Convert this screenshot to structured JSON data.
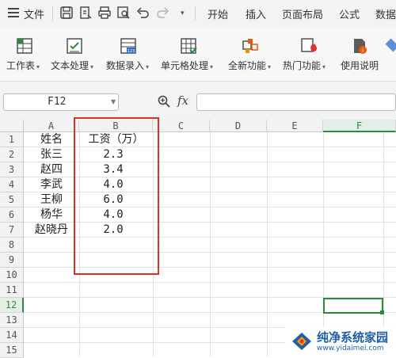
{
  "titlebar": {
    "file_label": "文件",
    "tabs": [
      "开始",
      "插入",
      "页面布局",
      "公式",
      "数据"
    ]
  },
  "ribbon": {
    "groups": [
      {
        "label": "工作表",
        "icon": "worksheet-icon"
      },
      {
        "label": "文本处理",
        "icon": "text-process-icon"
      },
      {
        "label": "数据录入",
        "icon": "data-entry-icon"
      },
      {
        "label": "单元格处理",
        "icon": "cell-process-icon"
      },
      {
        "label": "全新功能",
        "icon": "new-feature-icon"
      },
      {
        "label": "热门功能",
        "icon": "hot-feature-icon"
      },
      {
        "label": "使用说明",
        "icon": "help-doc-icon"
      }
    ]
  },
  "formula_bar": {
    "name_box": "F12",
    "fx_label": "fx",
    "formula_value": ""
  },
  "sheet": {
    "columns": [
      "A",
      "B",
      "C",
      "D",
      "E",
      "F"
    ],
    "rows": [
      "1",
      "2",
      "3",
      "4",
      "5",
      "6",
      "7",
      "8",
      "9",
      "10",
      "11",
      "12",
      "13",
      "14",
      "15"
    ],
    "selected_column": "F",
    "selected_row": "12",
    "cells": {
      "A1": "姓名",
      "B1": "工资（万）",
      "A2": "张三",
      "B2": "2.3",
      "A3": "赵四",
      "B3": "3.4",
      "A4": "李武",
      "B4": "4.0",
      "A5": "王柳",
      "B5": "6.0",
      "A6": "杨华",
      "B6": "4.0",
      "A7": "赵晓丹",
      "B7": "2.0"
    }
  },
  "watermark": {
    "title": "纯净系统家园",
    "url": "www.yidaimei.com"
  },
  "colors": {
    "highlight_box": "#d9302a",
    "selection": "#2b8a3e",
    "watermark_blue": "#1e5fa8"
  }
}
